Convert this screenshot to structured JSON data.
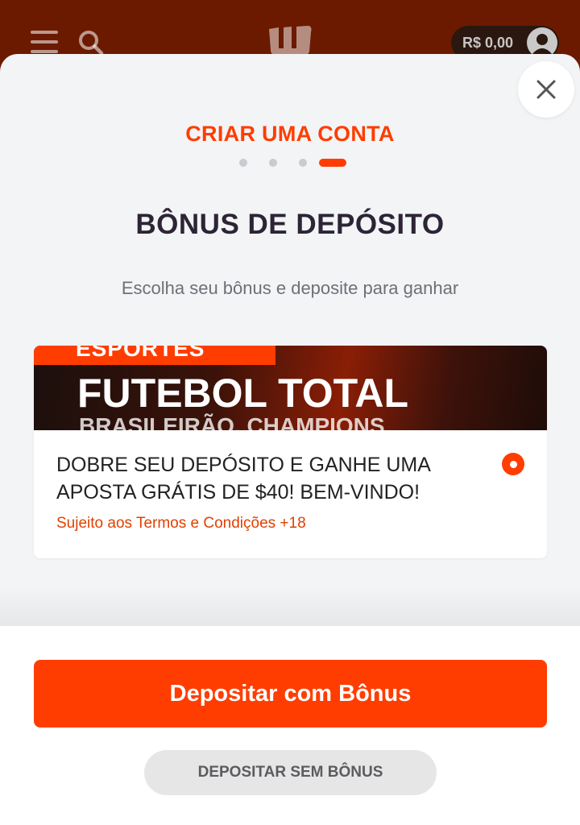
{
  "header": {
    "balance": "R$ 0,00",
    "menu_icon": "hamburger-menu-icon",
    "search_icon": "search-icon",
    "logo_icon": "brand-logo-icon",
    "avatar_icon": "user-avatar-icon"
  },
  "modal": {
    "step_title": "CRIAR UMA CONTA",
    "steps_total": 4,
    "current_step": 4,
    "heading": "BÔNUS DE DEPÓSITO",
    "subheading": "Escolha seu bônus e deposite para ganhar",
    "close_icon": "close-icon"
  },
  "bonus": {
    "banner_tag": "ESPORTES",
    "banner_title": "FUTEBOL TOTAL",
    "banner_subtitle": "BRASILEIRÃO, CHAMPIONS",
    "offer": "DOBRE SEU DEPÓSITO E GANHE UMA APOSTA GRÁTIS DE $40! BEM-VINDO!",
    "terms": "Sujeito aos Termos e Condições +18",
    "selected": true
  },
  "actions": {
    "primary": "Depositar com Bônus",
    "secondary": "DEPOSITAR SEM BÔNUS"
  },
  "colors": {
    "accent": "#ff3d00",
    "header_bg": "#6b1a00",
    "heading_text": "#2d2436"
  }
}
